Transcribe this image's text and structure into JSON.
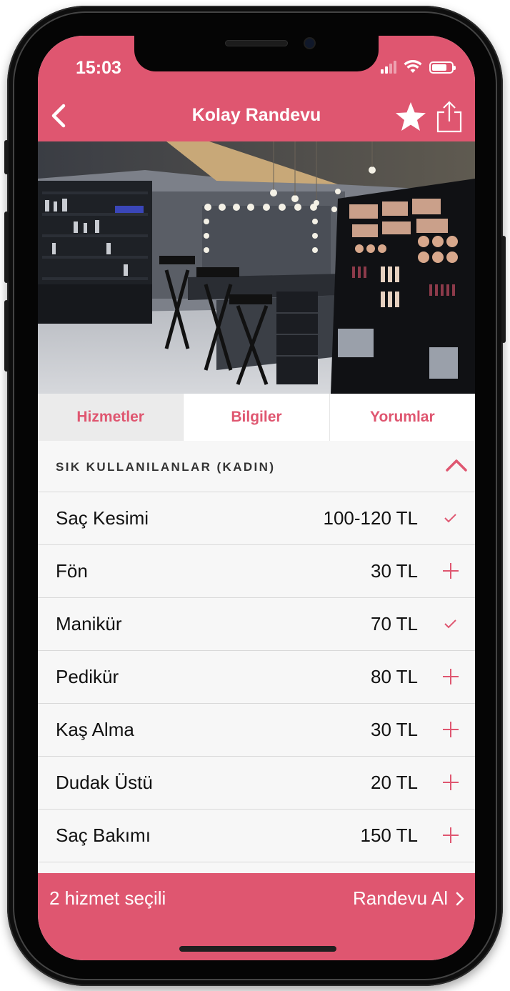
{
  "status_bar": {
    "time": "15:03"
  },
  "nav": {
    "title": "Kolay Randevu",
    "back_icon": "chevron-left-icon",
    "favorite_icon": "star-icon",
    "share_icon": "share-icon"
  },
  "hero": {
    "image": "salon-interior-photo"
  },
  "tabs": [
    {
      "label": "Hizmetler",
      "active": true
    },
    {
      "label": "Bilgiler",
      "active": false
    },
    {
      "label": "Yorumlar",
      "active": false
    }
  ],
  "section": {
    "title": "SIK KULLANILANLAR (KADIN)",
    "toggle_icon": "chevron-up-icon"
  },
  "services": [
    {
      "name": "Saç Kesimi",
      "price": "100-120 TL",
      "selected": true
    },
    {
      "name": "Fön",
      "price": "30 TL",
      "selected": false
    },
    {
      "name": "Manikür",
      "price": "70 TL",
      "selected": true
    },
    {
      "name": "Pedikür",
      "price": "80 TL",
      "selected": false
    },
    {
      "name": "Kaş Alma",
      "price": "30 TL",
      "selected": false
    },
    {
      "name": "Dudak Üstü",
      "price": "20 TL",
      "selected": false
    },
    {
      "name": "Saç Bakımı",
      "price": "150 TL",
      "selected": false
    }
  ],
  "bottom_bar": {
    "selected_text": "2 hizmet seçili",
    "action_label": "Randevu Al"
  },
  "colors": {
    "accent": "#df5670",
    "background": "#f7f7f7",
    "text": "#111111"
  }
}
